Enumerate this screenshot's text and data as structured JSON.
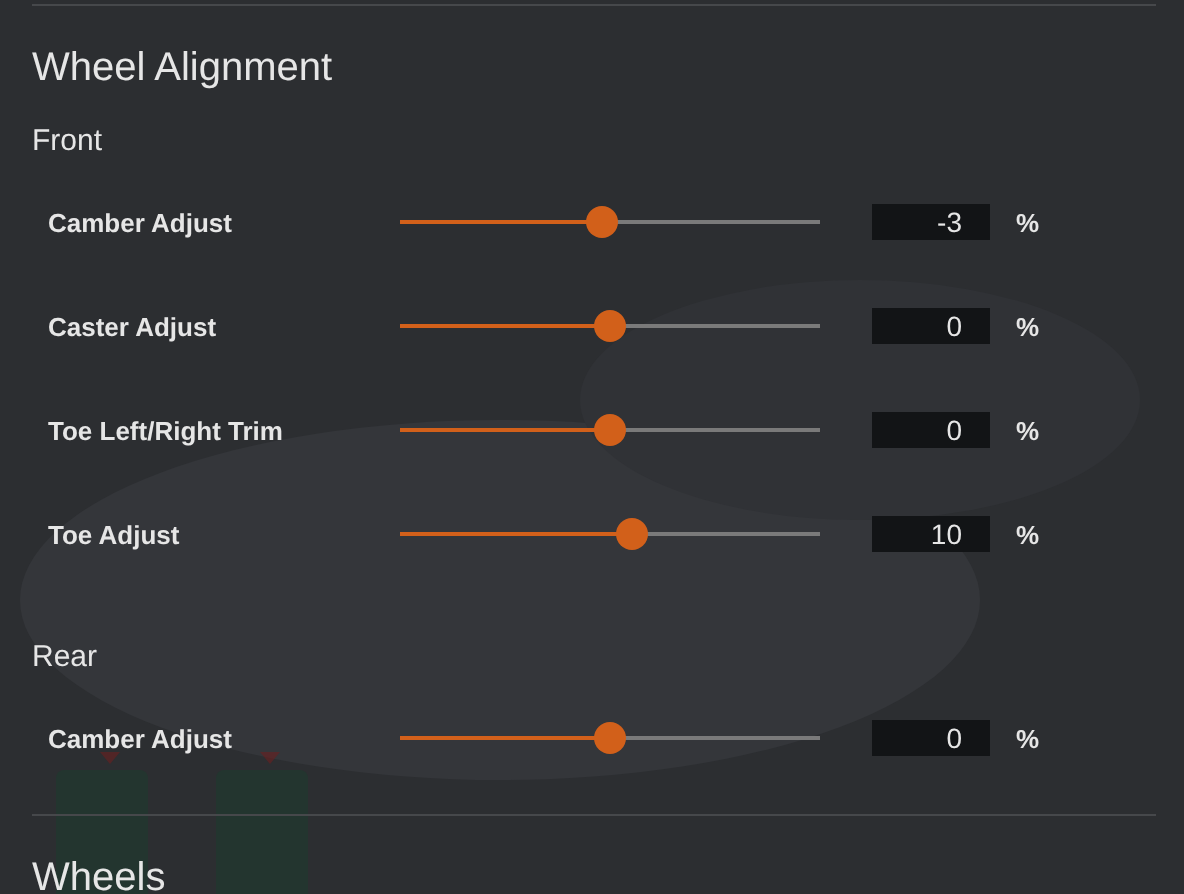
{
  "section": {
    "title": "Wheel Alignment"
  },
  "groups": [
    {
      "title": "Front",
      "rows": [
        {
          "label": "Camber Adjust",
          "level": 0.48,
          "value": "-3",
          "unit": "%"
        },
        {
          "label": "Caster Adjust",
          "level": 0.5,
          "value": "0",
          "unit": "%"
        },
        {
          "label": "Toe Left/Right Trim",
          "level": 0.5,
          "value": "0",
          "unit": "%"
        },
        {
          "label": "Toe Adjust",
          "level": 0.55,
          "value": "10",
          "unit": "%"
        }
      ]
    },
    {
      "title": "Rear",
      "rows": [
        {
          "label": "Camber Adjust",
          "level": 0.5,
          "value": "0",
          "unit": "%"
        }
      ]
    }
  ],
  "next_section": {
    "title": "Wheels"
  }
}
